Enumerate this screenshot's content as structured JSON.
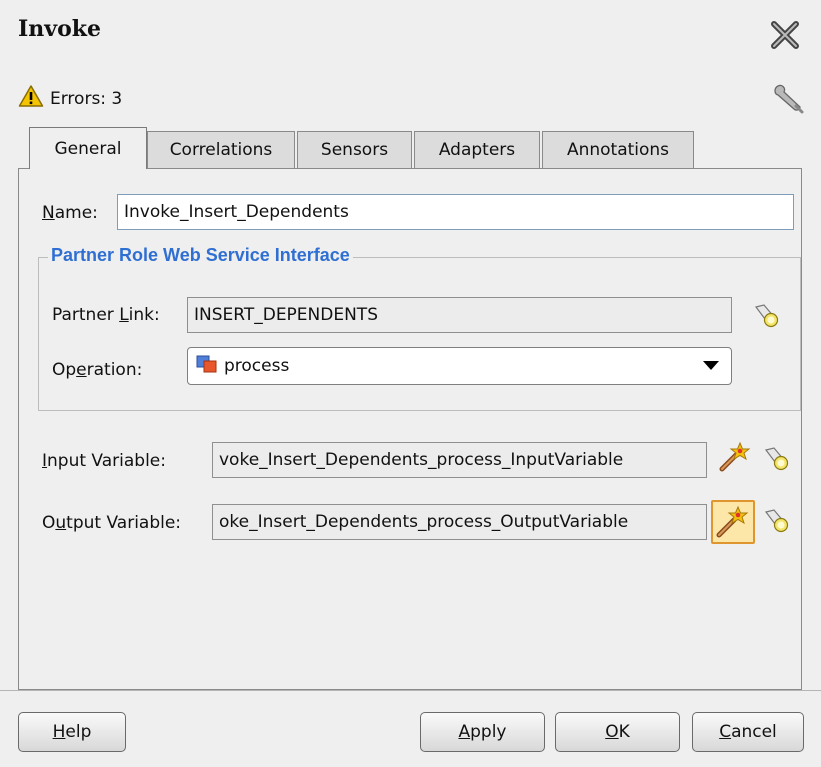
{
  "dialog": {
    "title": "Invoke",
    "errors_text": "Errors: 3"
  },
  "tabs": [
    {
      "label": "General",
      "active": true
    },
    {
      "label": "Correlations",
      "active": false
    },
    {
      "label": "Sensors",
      "active": false
    },
    {
      "label": "Adapters",
      "active": false
    },
    {
      "label": "Annotations",
      "active": false
    }
  ],
  "general": {
    "name_label_mnemonic": "N",
    "name_label_rest": "ame:",
    "name_value": "Invoke_Insert_Dependents",
    "group_title": "Partner Role Web Service Interface",
    "partner_link_label_pre": "Partner ",
    "partner_link_label_mnemonic": "L",
    "partner_link_label_post": "ink:",
    "partner_link_value": "INSERT_DEPENDENTS",
    "operation_label_pre": "Op",
    "operation_label_mnemonic": "e",
    "operation_label_post": "ration:",
    "operation_value": "process",
    "input_label_mnemonic": "I",
    "input_label_rest": "nput Variable:",
    "input_value": "voke_Insert_Dependents_process_InputVariable",
    "output_label_pre": "O",
    "output_label_mnemonic": "u",
    "output_label_post": "tput Variable:",
    "output_value": "oke_Insert_Dependents_process_OutputVariable"
  },
  "buttons": {
    "help_mnemonic": "H",
    "help_rest": "elp",
    "apply_mnemonic": "A",
    "apply_rest": "pply",
    "ok_mnemonic": "O",
    "ok_rest": "K",
    "cancel_mnemonic": "C",
    "cancel_rest": "ancel"
  },
  "colors": {
    "group_title": "#2f6fd2",
    "warning": "#f5c400",
    "highlight_border": "#e0962f"
  }
}
